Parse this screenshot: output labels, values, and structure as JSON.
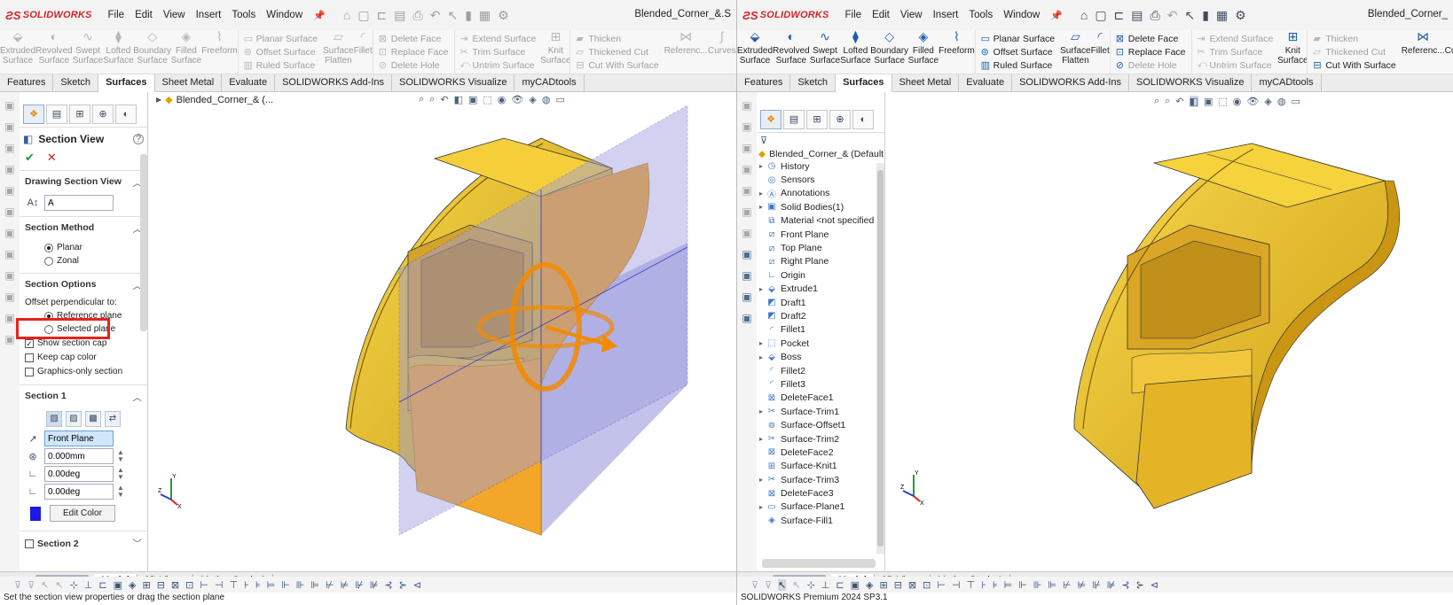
{
  "left": {
    "brand": "SOLIDWORKS",
    "menu": [
      "File",
      "Edit",
      "View",
      "Insert",
      "Tools",
      "Window"
    ],
    "doc_title": "Blended_Corner_&.S",
    "ribbon": {
      "extruded": "Extruded Surface",
      "revolved": "Revolved Surface",
      "swept": "Swept Surface",
      "lofted": "Lofted Surface",
      "boundary": "Boundary Surface",
      "filled": "Filled Surface",
      "freeform": "Freeform",
      "planar": "Planar Surface",
      "offset": "Offset Surface",
      "ruled": "Ruled Surface",
      "flatten": "Surface Flatten",
      "fillet": "Fillet",
      "delete_face": "Delete Face",
      "replace_face": "Replace Face",
      "delete_hole": "Delete Hole",
      "extend": "Extend Surface",
      "trim": "Trim Surface",
      "untrim": "Untrim Surface",
      "knit": "Knit Surface",
      "thicken": "Thicken",
      "thickened_cut": "Thickened Cut",
      "cut_with": "Cut With Surface",
      "reference": "Referenc...",
      "curves": "Curves"
    },
    "tabs": [
      "Features",
      "Sketch",
      "Surfaces",
      "Sheet Metal",
      "Evaluate",
      "SOLIDWORKS Add-Ins",
      "SOLIDWORKS Visualize",
      "myCADtools"
    ],
    "breadcrumb": "Blended_Corner_& (...",
    "pm": {
      "title": "Section View",
      "drawing_section_view": "Drawing Section View",
      "section_label": "A",
      "section_method": "Section Method",
      "planar": "Planar",
      "zonal": "Zonal",
      "section_options": "Section Options",
      "offset_perp": "Offset perpendicular to:",
      "reference_plane": "Reference plane",
      "selected_plane": "Selected plane",
      "show_section_cap": "Show section cap",
      "keep_cap_color": "Keep cap color",
      "graphics_only": "Graphics-only section",
      "section1": "Section 1",
      "front_plane": "Front Plane",
      "offset_value": "0.000mm",
      "angle1": "0.00deg",
      "angle2": "0.00deg",
      "edit_color": "Edit Color",
      "section2": "Section 2"
    },
    "bottom_tabs": [
      "Model",
      "3D Views",
      "Motion Study 1"
    ],
    "status": "Set the section view properties or drag the section plane"
  },
  "right": {
    "brand": "SOLIDWORKS",
    "menu": [
      "File",
      "Edit",
      "View",
      "Insert",
      "Tools",
      "Window"
    ],
    "doc_title": "Blended_Corner_",
    "ribbon": {
      "extruded": "Extruded Surface",
      "revolved": "Revolved Surface",
      "swept": "Swept Surface",
      "lofted": "Lofted Surface",
      "boundary": "Boundary Surface",
      "filled": "Filled Surface",
      "freeform": "Freeform",
      "planar": "Planar Surface",
      "offset": "Offset Surface",
      "ruled": "Ruled Surface",
      "flatten": "Surface Flatten",
      "fillet": "Fillet",
      "delete_face": "Delete Face",
      "replace_face": "Replace Face",
      "delete_hole": "Delete Hole",
      "extend": "Extend Surface",
      "trim": "Trim Surface",
      "untrim": "Untrim Surface",
      "knit": "Knit Surface",
      "thicken": "Thicken",
      "thickened_cut": "Thickened Cut",
      "cut_with": "Cut With Surface",
      "reference": "Referenc...",
      "curves": "Curve"
    },
    "tabs": [
      "Features",
      "Sketch",
      "Surfaces",
      "Sheet Metal",
      "Evaluate",
      "SOLIDWORKS Add-Ins",
      "SOLIDWORKS Visualize",
      "myCADtools"
    ],
    "tree_root": "Blended_Corner_& (Default",
    "tree": [
      "History",
      "Sensors",
      "Annotations",
      "Solid Bodies(1)",
      "Material <not specified",
      "Front Plane",
      "Top Plane",
      "Right Plane",
      "Origin",
      "Extrude1",
      "Draft1",
      "Draft2",
      "Fillet1",
      "Pocket",
      "Boss",
      "Fillet2",
      "Fillet3",
      "DeleteFace1",
      "Surface-Trim1",
      "Surface-Offset1",
      "Surface-Trim2",
      "DeleteFace2",
      "Surface-Knit1",
      "Surface-Trim3",
      "DeleteFace3",
      "Surface-Plane1",
      "Surface-Fill1"
    ],
    "bottom_tabs": [
      "Model",
      "3D Views",
      "Motion Study 1"
    ],
    "status": "SOLIDWORKS Premium 2024 SP3.1"
  },
  "colors": {
    "part_yellow": "#f2c21b",
    "section_cap_orange": "#f5a31a",
    "section_plane": "#b7b7e6",
    "highlight_red": "#e8221a",
    "brand_red": "#d3252a"
  }
}
